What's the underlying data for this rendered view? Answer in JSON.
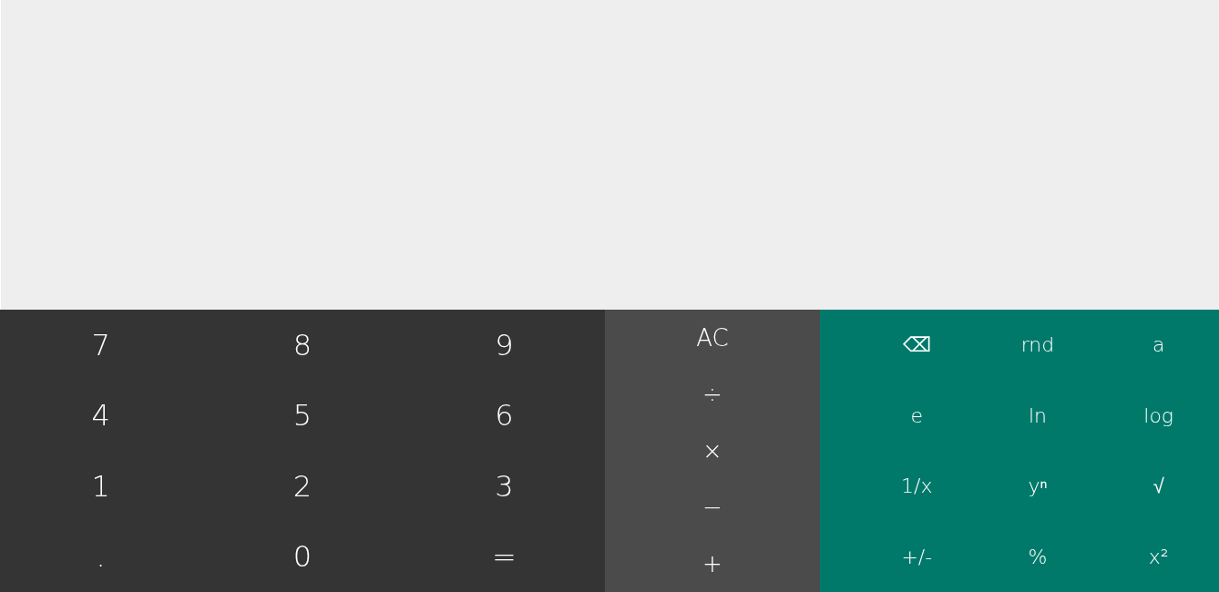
{
  "digits": [
    [
      "7",
      "8",
      "9"
    ],
    [
      "4",
      "5",
      "6"
    ],
    [
      "1",
      "2",
      "3"
    ],
    [
      ".",
      "0",
      "="
    ]
  ],
  "operators": [
    "AC",
    "÷",
    "×",
    "−",
    "+"
  ],
  "advanced": [
    [
      "⌫",
      "rnd",
      "a"
    ],
    [
      "e",
      "ln",
      "log"
    ],
    [
      "1/x",
      "yⁿ",
      "√"
    ],
    [
      "+/-",
      "%",
      "x²"
    ]
  ]
}
